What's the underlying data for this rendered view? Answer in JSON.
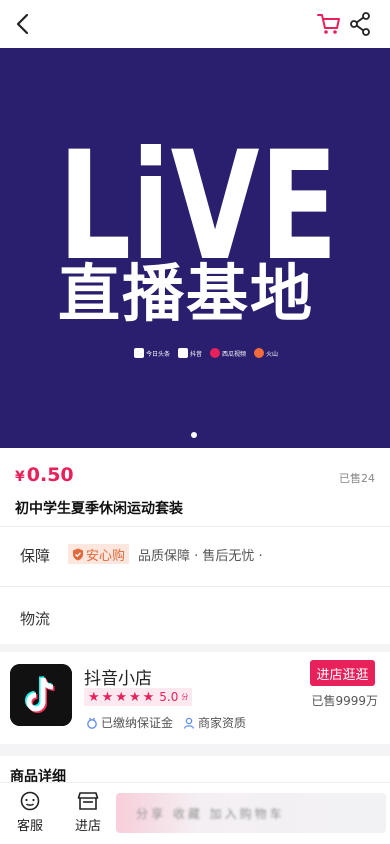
{
  "header": {
    "back_icon": "chevron-left-icon",
    "cart_icon": "cart-icon",
    "share_icon": "share-icon",
    "cart_color": "#e8215a"
  },
  "banner": {
    "background": "#2a1f6e",
    "headline": "LiVE",
    "subtitle": "直播基地",
    "platforms": [
      "今日头条",
      "抖音",
      "西瓜视频",
      "火山"
    ],
    "carousel_dots": 1
  },
  "product": {
    "currency": "¥",
    "price": "0.50",
    "sold": "已售24",
    "title": "初中学生夏季休闲运动套装"
  },
  "guarantee": {
    "label": "保障",
    "badge": "安心购",
    "text": "品质保障 · 售后无忧 ·"
  },
  "logistics": {
    "label": "物流"
  },
  "shop": {
    "name": "抖音小店",
    "rating": "5.0",
    "rating_suffix": "分",
    "stars": 5,
    "enter_button": "进店逛逛",
    "sold": "已售9999万",
    "tags": [
      {
        "icon": "medal-icon",
        "label": "已缴纳保证金"
      },
      {
        "icon": "user-badge-icon",
        "label": "商家资质"
      }
    ]
  },
  "detail": {
    "heading": "商品详细"
  },
  "bottom_nav": {
    "items": [
      {
        "icon": "customer-service-icon",
        "label": "客服"
      },
      {
        "icon": "store-icon",
        "label": "进店"
      }
    ],
    "ghost_text": "分享 收藏 加入购物车"
  },
  "colors": {
    "accent": "#e8215a",
    "badge_bg": "#fde6dd",
    "badge_text": "#e06a3c"
  }
}
